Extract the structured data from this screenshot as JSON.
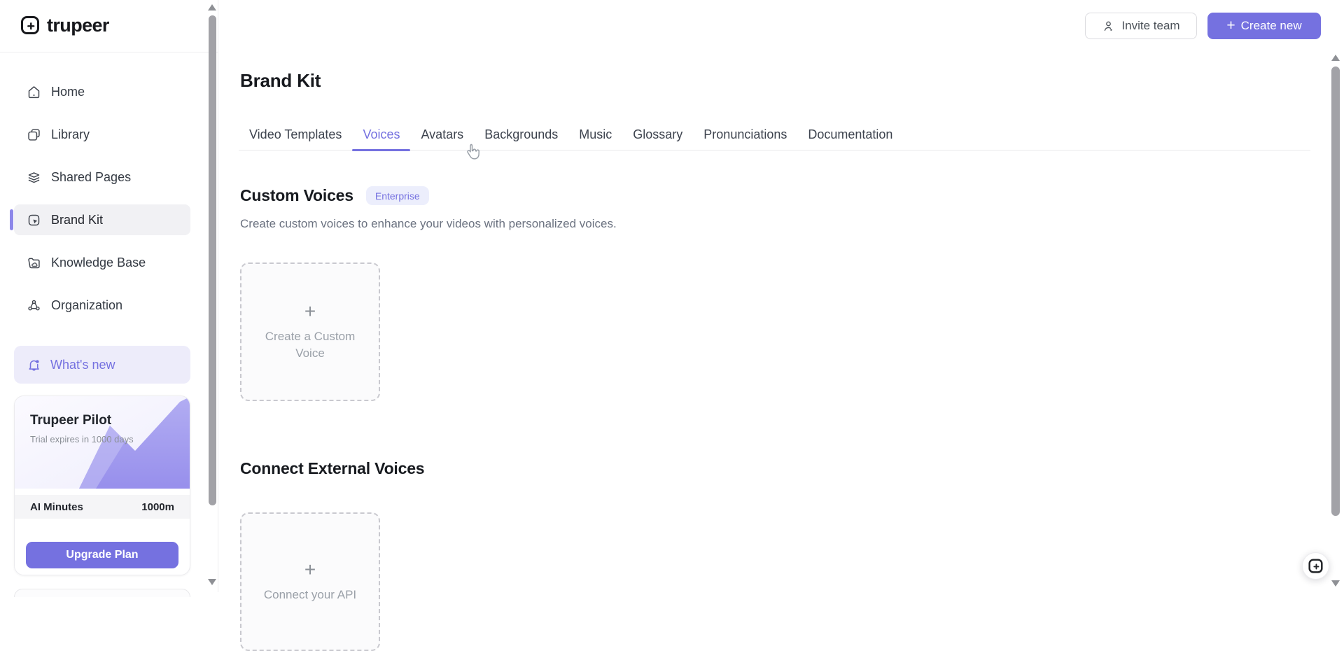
{
  "app": {
    "name": "trupeer"
  },
  "icons": {
    "plus": "+"
  },
  "header": {
    "invite_team_label": "Invite team",
    "create_new_label": "Create new"
  },
  "sidebar": {
    "items": [
      {
        "label": "Home"
      },
      {
        "label": "Library"
      },
      {
        "label": "Shared Pages"
      },
      {
        "label": "Brand Kit",
        "active": true
      },
      {
        "label": "Knowledge Base"
      },
      {
        "label": "Organization"
      }
    ],
    "whats_new_label": "What's new",
    "plan_card": {
      "title": "Trupeer Pilot",
      "trial_note": "Trial expires in 1000 days",
      "usage_label": "AI Minutes",
      "usage_value": "1000m",
      "upgrade_label": "Upgrade Plan"
    }
  },
  "page": {
    "title": "Brand Kit",
    "active_tab": "Voices",
    "tabs": [
      "Video Templates",
      "Voices",
      "Avatars",
      "Backgrounds",
      "Music",
      "Glossary",
      "Pronunciations",
      "Documentation"
    ],
    "sections": {
      "custom_voices": {
        "heading": "Custom Voices",
        "badge": "Enterprise",
        "description": "Create custom voices to enhance your videos with personalized voices.",
        "create_card_label": "Create a Custom Voice"
      },
      "external_voices": {
        "heading": "Connect External Voices",
        "connect_card_label": "Connect your API"
      }
    }
  },
  "colors": {
    "accent": "#7571e0",
    "accent_soft": "#edecfa",
    "active_item_bg": "#f1f1f4",
    "scrollbar_thumb": "#a2a2a7"
  }
}
